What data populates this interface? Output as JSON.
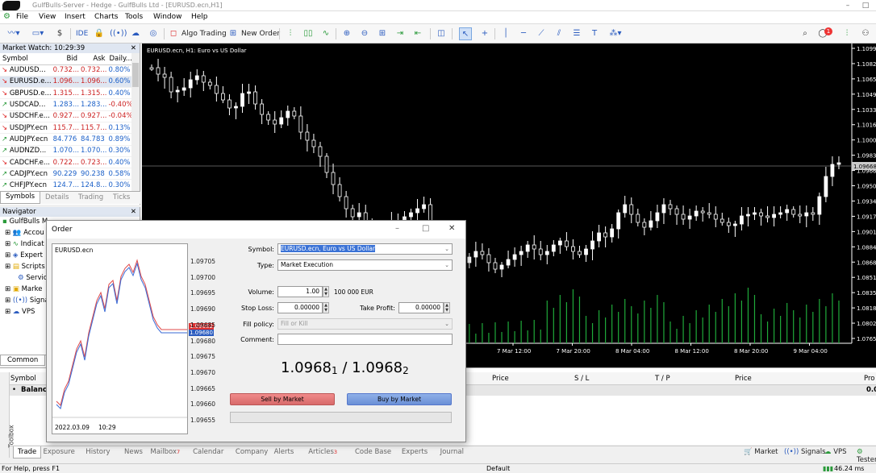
{
  "window": {
    "title": "GulfBulls-Server - Hedge - GulfBulls Ltd - [EURUSD.ecn,H1]",
    "controls": [
      "–",
      "□",
      "✕"
    ]
  },
  "menu": [
    "File",
    "View",
    "Insert",
    "Charts",
    "Tools",
    "Window",
    "Help"
  ],
  "toolbar": {
    "ide": "IDE",
    "algo_trading": "Algo Trading",
    "new_order": "New Order",
    "notification_count": "1"
  },
  "market_watch": {
    "title": "Market Watch: 10:29:39",
    "columns": [
      "Symbol",
      "Bid",
      "Ask",
      "Daily..."
    ],
    "rows": [
      {
        "dir": "down",
        "symbol": "AUDUSD...",
        "bid": "0.732...",
        "ask": "0.732...",
        "daily": "0.80%"
      },
      {
        "dir": "down",
        "symbol": "EURUSD.e...",
        "bid": "1.096...",
        "ask": "1.096...",
        "daily": "0.60%"
      },
      {
        "dir": "down",
        "symbol": "GBPUSD.e...",
        "bid": "1.315...",
        "ask": "1.315...",
        "daily": "0.40%"
      },
      {
        "dir": "up",
        "symbol": "USDCAD...",
        "bid": "1.283...",
        "ask": "1.283...",
        "daily": "-0.40%"
      },
      {
        "dir": "down",
        "symbol": "USDCHF.e...",
        "bid": "0.927...",
        "ask": "0.927...",
        "daily": "-0.04%"
      },
      {
        "dir": "down",
        "symbol": "USDJPY.ecn",
        "bid": "115.7...",
        "ask": "115.7...",
        "daily": "0.13%"
      },
      {
        "dir": "up",
        "symbol": "AUDJPY.ecn",
        "bid": "84.776",
        "ask": "84.783",
        "daily": "0.89%"
      },
      {
        "dir": "up",
        "symbol": "AUDNZD...",
        "bid": "1.070...",
        "ask": "1.070...",
        "daily": "0.30%"
      },
      {
        "dir": "down",
        "symbol": "CADCHF.e...",
        "bid": "0.722...",
        "ask": "0.723...",
        "daily": "0.40%"
      },
      {
        "dir": "up",
        "symbol": "CADJPY.ecn",
        "bid": "90.229",
        "ask": "90.238",
        "daily": "0.58%"
      },
      {
        "dir": "up",
        "symbol": "CHFJPY.ecn",
        "bid": "124.7...",
        "ask": "124.8...",
        "daily": "0.30%"
      }
    ],
    "tabs": [
      "Symbols",
      "Details",
      "Trading",
      "Ticks"
    ]
  },
  "navigator": {
    "title": "Navigator",
    "items": [
      "GulfBulls M",
      "Accou",
      "Indicat",
      "Expert",
      "Scripts",
      "Servic",
      "Marke",
      "Signal",
      "VPS"
    ],
    "tab": "Common"
  },
  "chart": {
    "label": "EURUSD.ecn, H1:  Euro vs US Dollar",
    "price_ticks": [
      "1.10996",
      "1.10826",
      "1.10656",
      "1.10491",
      "1.10336",
      "1.10161",
      "1.10000",
      "1.09836",
      "1.09668",
      "1.09501",
      "1.09340",
      "1.09175",
      "1.09010",
      "1.08849",
      "1.08680",
      "1.08515",
      "1.08350",
      "1.08185",
      "1.08020",
      "1.07659"
    ],
    "time_ticks": [
      "7 Mar 12:00",
      "7 Mar 20:00",
      "8 Mar 04:00",
      "8 Mar 12:00",
      "8 Mar 20:00",
      "9 Mar 04:00"
    ],
    "current_price": "1.09668"
  },
  "order_dialog": {
    "title": "Order",
    "mini_chart": {
      "symbol": "EURUSD.ecn",
      "ticks": [
        "1.09705",
        "1.09700",
        "1.09695",
        "1.09690",
        "1.09685",
        "1.09680",
        "1.09675",
        "1.09670",
        "1.09665",
        "1.09660",
        "1.09655"
      ],
      "date": "2022.03.09",
      "time": "10:29",
      "price_bid": "1.09682",
      "price_ask": "1.09680"
    },
    "symbol_label": "Symbol:",
    "symbol_value": "EURUSD.ecn, Euro vs US Dollar",
    "type_label": "Type:",
    "type_value": "Market Execution",
    "volume_label": "Volume:",
    "volume_value": "1.00",
    "volume_note": "100 000 EUR",
    "sl_label": "Stop Loss:",
    "sl_value": "0.00000",
    "tp_label": "Take Profit:",
    "tp_value": "0.00000",
    "fill_label": "Fill policy:",
    "fill_value": "Fill or Kill",
    "comment_label": "Comment:",
    "bid_main": "1.0968",
    "bid_small": "1",
    "ask_main": "1.0968",
    "ask_small": "2",
    "sell_label": "Sell by Market",
    "buy_label": "Buy by Market"
  },
  "toolbox": {
    "side_label": "Toolbox",
    "columns": [
      "Symbol",
      "Price",
      "S / L",
      "T / P",
      "Price",
      "Pro"
    ],
    "balance_label": "Balance",
    "balance_value": "0.0",
    "tabs": [
      {
        "label": "Trade",
        "sup": ""
      },
      {
        "label": "Exposure",
        "sup": ""
      },
      {
        "label": "History",
        "sup": ""
      },
      {
        "label": "News",
        "sup": ""
      },
      {
        "label": "Mailbox",
        "sup": "7"
      },
      {
        "label": "Calendar",
        "sup": ""
      },
      {
        "label": "Company",
        "sup": ""
      },
      {
        "label": "Alerts",
        "sup": ""
      },
      {
        "label": "Articles",
        "sup": "3"
      },
      {
        "label": "Code Base",
        "sup": ""
      },
      {
        "label": "Experts",
        "sup": ""
      },
      {
        "label": "Journal",
        "sup": ""
      }
    ],
    "right_items": [
      "Market",
      "Signals",
      "VPS",
      "Tester"
    ]
  },
  "status": {
    "help": "For Help, press F1",
    "profile": "Default",
    "ping": "46.24 ms"
  }
}
